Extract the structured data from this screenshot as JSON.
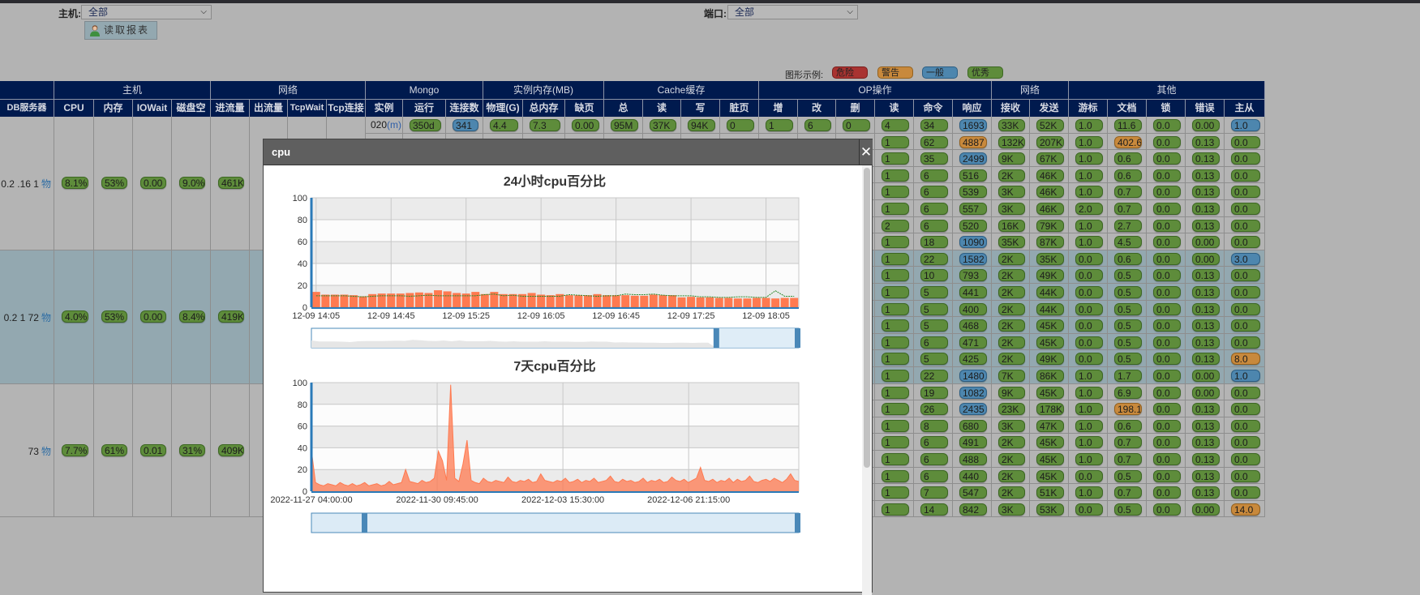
{
  "filters": {
    "host_label": "主机:",
    "host_value": "全部",
    "port_label": "端口:",
    "port_value": "全部",
    "read_report": "读取报表"
  },
  "legend": {
    "label": "图形示例:",
    "items": [
      {
        "label": "危险",
        "level": "danger",
        "color": "#a93331"
      },
      {
        "label": "警告",
        "level": "warn",
        "color": "#c8893c"
      },
      {
        "label": "一般",
        "level": "normal",
        "color": "#4d86ae"
      },
      {
        "label": "优秀",
        "level": "good",
        "color": "#5e8c3b"
      }
    ]
  },
  "table": {
    "groups": [
      "",
      "主机",
      "网络",
      "Mongo",
      "实例内存(MB)",
      "Cache缓存",
      "OP操作",
      "网络",
      "其他"
    ],
    "columns": [
      "DB服务器",
      "CPU",
      "内存",
      "IOWait",
      "磁盘空间",
      "进流量",
      "出流量",
      "TcpWait",
      "Tcp连接",
      "实例",
      "运行",
      "连接数",
      "物理(G)",
      "总内存(G)",
      "缺页",
      "总",
      "读",
      "写",
      "脏页",
      "增",
      "改",
      "删",
      "读",
      "命令",
      "响应",
      "接收",
      "发送",
      "游标",
      "文档",
      "锁",
      "错误",
      "主从"
    ],
    "servers": [
      {
        "name": "0.2  .16  1",
        "link": "物",
        "cpu": "8.1%",
        "mem": "53%",
        "iowait": "0.00",
        "disk": "9.0%",
        "in": "461K",
        "highlight": false
      },
      {
        "name": "0.2   1  72",
        "link": "物",
        "cpu": "4.0%",
        "mem": "53%",
        "iowait": "0.00",
        "disk": "8.4%",
        "in": "419K",
        "highlight": true
      },
      {
        "name": "73",
        "link": "物",
        "cpu": "7.7%",
        "mem": "61%",
        "iowait": "0.01",
        "disk": "31%",
        "in": "409K",
        "highlight": false
      }
    ],
    "first_instance": {
      "name": "020",
      "link": "(m)",
      "values": [
        "350d",
        "341",
        "4.4",
        "7.3",
        "0.00",
        "95M",
        "37K",
        "94K",
        "0",
        "1",
        "6",
        "0"
      ],
      "levels": {
        "1": "normal"
      }
    },
    "rows": [
      {
        "v": [
          "4",
          "34",
          "1693",
          "33K",
          "52K",
          "1.0",
          "11.6",
          "0.0",
          "0.00",
          "1.0"
        ],
        "l": {
          "2": "normal",
          "9": "normal"
        }
      },
      {
        "v": [
          "1",
          "62",
          "4887",
          "132K",
          "207K",
          "1.0",
          "402.6",
          "0.0",
          "0.13",
          "0.0"
        ],
        "l": {
          "2": "warn",
          "6": "warn"
        }
      },
      {
        "v": [
          "1",
          "35",
          "2499",
          "9K",
          "67K",
          "1.0",
          "0.6",
          "0.0",
          "0.13",
          "0.0"
        ],
        "l": {
          "2": "normal"
        }
      },
      {
        "v": [
          "1",
          "6",
          "516",
          "2K",
          "46K",
          "1.0",
          "0.6",
          "0.0",
          "0.13",
          "0.0"
        ],
        "l": {}
      },
      {
        "v": [
          "1",
          "6",
          "539",
          "3K",
          "46K",
          "1.0",
          "0.7",
          "0.0",
          "0.13",
          "0.0"
        ],
        "l": {}
      },
      {
        "v": [
          "1",
          "6",
          "557",
          "3K",
          "46K",
          "2.0",
          "0.7",
          "0.0",
          "0.13",
          "0.0"
        ],
        "l": {}
      },
      {
        "v": [
          "2",
          "6",
          "520",
          "16K",
          "79K",
          "1.0",
          "2.7",
          "0.0",
          "0.13",
          "0.0"
        ],
        "l": {}
      },
      {
        "v": [
          "1",
          "18",
          "1090",
          "35K",
          "87K",
          "1.0",
          "4.5",
          "0.0",
          "0.00",
          "0.0"
        ],
        "l": {
          "2": "normal"
        }
      },
      {
        "v": [
          "1",
          "22",
          "1582",
          "2K",
          "35K",
          "0.0",
          "0.6",
          "0.0",
          "0.00",
          "3.0"
        ],
        "l": {
          "2": "normal",
          "9": "normal"
        }
      },
      {
        "v": [
          "1",
          "10",
          "793",
          "2K",
          "49K",
          "0.0",
          "0.5",
          "0.0",
          "0.13",
          "0.0"
        ],
        "l": {}
      },
      {
        "v": [
          "1",
          "5",
          "441",
          "2K",
          "44K",
          "0.0",
          "0.5",
          "0.0",
          "0.13",
          "0.0"
        ],
        "l": {}
      },
      {
        "v": [
          "1",
          "5",
          "400",
          "2K",
          "44K",
          "0.0",
          "0.5",
          "0.0",
          "0.13",
          "0.0"
        ],
        "l": {}
      },
      {
        "v": [
          "1",
          "5",
          "468",
          "2K",
          "45K",
          "0.0",
          "0.5",
          "0.0",
          "0.13",
          "0.0"
        ],
        "l": {}
      },
      {
        "v": [
          "1",
          "6",
          "471",
          "2K",
          "45K",
          "0.0",
          "0.5",
          "0.0",
          "0.13",
          "0.0"
        ],
        "l": {}
      },
      {
        "v": [
          "1",
          "5",
          "425",
          "2K",
          "49K",
          "0.0",
          "0.5",
          "0.0",
          "0.13",
          "8.0"
        ],
        "l": {
          "9": "warn"
        }
      },
      {
        "v": [
          "1",
          "22",
          "1480",
          "7K",
          "86K",
          "1.0",
          "1.7",
          "0.0",
          "0.00",
          "1.0"
        ],
        "l": {
          "2": "normal",
          "9": "normal"
        }
      },
      {
        "v": [
          "1",
          "19",
          "1082",
          "9K",
          "45K",
          "1.0",
          "6.9",
          "0.0",
          "0.00",
          "0.0"
        ],
        "l": {
          "2": "normal"
        }
      },
      {
        "v": [
          "1",
          "26",
          "2435",
          "23K",
          "178K",
          "1.0",
          "198.1",
          "0.0",
          "0.13",
          "0.0"
        ],
        "l": {
          "2": "normal",
          "6": "warn"
        }
      },
      {
        "v": [
          "1",
          "8",
          "680",
          "3K",
          "47K",
          "1.0",
          "0.6",
          "0.0",
          "0.13",
          "0.0"
        ],
        "l": {}
      },
      {
        "v": [
          "1",
          "6",
          "491",
          "2K",
          "45K",
          "1.0",
          "0.7",
          "0.0",
          "0.13",
          "0.0"
        ],
        "l": {}
      },
      {
        "v": [
          "1",
          "6",
          "488",
          "2K",
          "45K",
          "1.0",
          "0.7",
          "0.0",
          "0.13",
          "0.0"
        ],
        "l": {}
      },
      {
        "v": [
          "1",
          "6",
          "440",
          "2K",
          "45K",
          "0.0",
          "0.5",
          "0.0",
          "0.13",
          "0.0"
        ],
        "l": {}
      },
      {
        "v": [
          "1",
          "7",
          "547",
          "2K",
          "51K",
          "1.0",
          "0.7",
          "0.0",
          "0.13",
          "0.0"
        ],
        "l": {}
      },
      {
        "v": [
          "1",
          "14",
          "842",
          "3K",
          "53K",
          "0.0",
          "0.5",
          "0.0",
          "0.00",
          "14.0"
        ],
        "l": {
          "9": "warn"
        }
      }
    ]
  },
  "modal": {
    "title": "cpu",
    "close": "✕"
  },
  "chart_data": [
    {
      "type": "bar",
      "title": "24小时cpu百分比",
      "ylim": [
        0,
        100
      ],
      "yticks": [
        "0",
        "20",
        "40",
        "60",
        "80",
        "100"
      ],
      "xticks": [
        "12-09 14:05",
        "12-09 14:45",
        "12-09 15:25",
        "12-09 16:05",
        "12-09 16:45",
        "12-09 17:25",
        "12-09 18:05"
      ],
      "grid": true,
      "bar_color": "#ff7a50",
      "line_color": "#2a8a2a",
      "series": [
        {
          "type": "bar",
          "values": [
            14,
            11.5,
            11.5,
            11.5,
            11,
            10,
            12,
            12.5,
            12.5,
            12.5,
            13,
            13.5,
            13,
            15.5,
            14.5,
            13,
            12.5,
            14,
            12,
            14,
            12,
            12,
            12,
            13,
            11.5,
            11,
            12,
            11,
            11,
            11,
            12,
            11,
            11,
            11,
            10.5,
            10.5,
            11.5,
            11,
            11,
            9,
            9.5,
            9,
            9,
            8.5,
            8.5,
            8,
            8,
            8.5,
            8.5,
            8,
            8.5,
            8.5
          ]
        },
        {
          "type": "line",
          "values": [
            10.5,
            10.5,
            10.5,
            10.5,
            10,
            9.5,
            10,
            10.5,
            10.5,
            10.5,
            10,
            10.5,
            11,
            10.5,
            10.5,
            10.5,
            10.5,
            10.5,
            11.5,
            12,
            10.5,
            11,
            10,
            10,
            10,
            10,
            10,
            11.5,
            11,
            10.5,
            10,
            10.5,
            10.5,
            12,
            11.5,
            11.5,
            12,
            11,
            10.5,
            10.5,
            10.5,
            9.5,
            9.5,
            9,
            9,
            9.5,
            9.5,
            9,
            9,
            15,
            10,
            10
          ]
        }
      ]
    },
    {
      "type": "area",
      "title": "7天cpu百分比",
      "ylim": [
        0,
        100
      ],
      "yticks": [
        "0",
        "20",
        "40",
        "60",
        "80",
        "100"
      ],
      "xticks": [
        "2022-11-27 04:00:00",
        "2022-11-30 09:45:00",
        "2022-12-03 15:30:00",
        "2022-12-06 21:15:00"
      ],
      "grid": true,
      "color": "#ff7a50",
      "series": [
        {
          "type": "area",
          "values": [
            38,
            8,
            6,
            5,
            7,
            6,
            5,
            8,
            6,
            5,
            7,
            5,
            6,
            8,
            5,
            6,
            7,
            5,
            6,
            9,
            6,
            7,
            8,
            20,
            9,
            8,
            7,
            10,
            8,
            9,
            12,
            37,
            28,
            10,
            98,
            12,
            9,
            25,
            47,
            10,
            8,
            7,
            12,
            9,
            8,
            10,
            9,
            8,
            13,
            9,
            8,
            10,
            9,
            11,
            8,
            9,
            16,
            10,
            9,
            8,
            10,
            9,
            12,
            8,
            9,
            11,
            8,
            10,
            9,
            12,
            8,
            9,
            10,
            14,
            9,
            8,
            11,
            9,
            10,
            8,
            9,
            12,
            8,
            10,
            9,
            11,
            8,
            9,
            13,
            10,
            9,
            11,
            8,
            10,
            12,
            22,
            10,
            9,
            11,
            8,
            10,
            9,
            12,
            8,
            11,
            9,
            10,
            14,
            9,
            8,
            10,
            11,
            9,
            12,
            10,
            8,
            11,
            16,
            10,
            9
          ]
        }
      ]
    }
  ]
}
